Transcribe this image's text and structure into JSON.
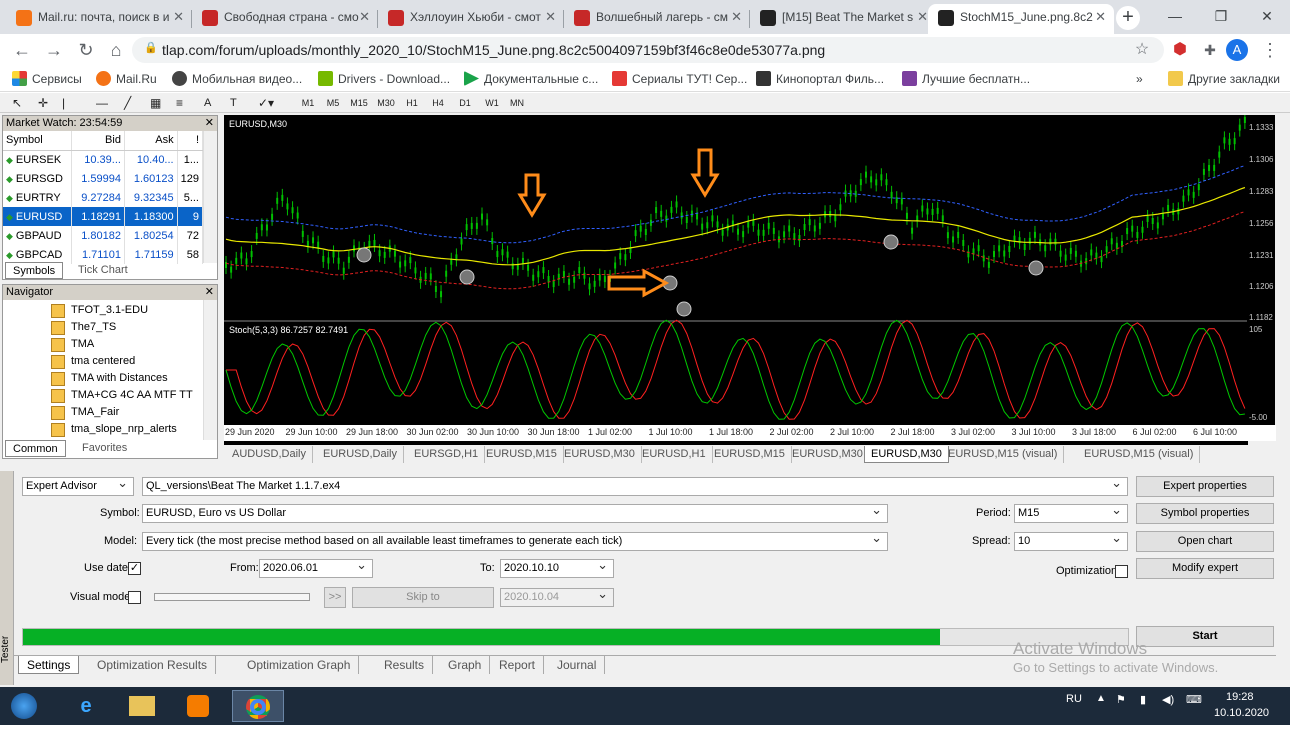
{
  "browser": {
    "tabs": [
      {
        "title": "Mail.ru: почта, поиск в и",
        "color": "#f47216"
      },
      {
        "title": "Свободная страна - смо",
        "color": "#c62828"
      },
      {
        "title": "Хэллоуин Хьюби - смот",
        "color": "#c62828"
      },
      {
        "title": "Волшебный лагерь - см",
        "color": "#c62828"
      },
      {
        "title": "[M15] Beat The Market s",
        "color": "#222222"
      },
      {
        "title": "StochM15_June.png.8c2",
        "color": "#222222"
      }
    ],
    "url": "tlap.com/forum/uploads/monthly_2020_10/StochM15_June.png.8c2c5004097159bf3f46c8e0de53077a.png",
    "avatar": "A",
    "bookmarks": [
      "Сервисы",
      "Mail.Ru",
      "Мобильная видео...",
      "Drivers - Download...",
      "Документальные с...",
      "Сериалы ТУТ! Сер...",
      "Кинопортал Филь...",
      "Лучшие бесплатн..."
    ],
    "other_bookmarks": "Другие закладки"
  },
  "mt4": {
    "timeframes": [
      "M1",
      "M5",
      "M15",
      "M30",
      "H1",
      "H4",
      "D1",
      "W1",
      "MN"
    ],
    "market_watch": {
      "title": "Market Watch: 23:54:59",
      "columns": [
        "Symbol",
        "Bid",
        "Ask",
        "!"
      ],
      "rows": [
        {
          "symbol": "EURSEK",
          "bid": "10.39...",
          "ask": "10.40...",
          "spread": "1..."
        },
        {
          "symbol": "EURSGD",
          "bid": "1.59994",
          "ask": "1.60123",
          "spread": "129"
        },
        {
          "symbol": "EURTRY",
          "bid": "9.27284",
          "ask": "9.32345",
          "spread": "5..."
        },
        {
          "symbol": "EURUSD",
          "bid": "1.18291",
          "ask": "1.18300",
          "spread": "9"
        },
        {
          "symbol": "GBPAUD",
          "bid": "1.80182",
          "ask": "1.80254",
          "spread": "72"
        },
        {
          "symbol": "GBPCAD",
          "bid": "1.71101",
          "ask": "1.71159",
          "spread": "58"
        }
      ],
      "tabs": [
        "Symbols",
        "Tick Chart"
      ]
    },
    "navigator": {
      "title": "Navigator",
      "items": [
        "TFOT_3.1-EDU",
        "The7_TS",
        "TMA",
        "tma centered",
        "TMA with Distances",
        "TMA+CG 4C AA MTF TT",
        "TMA_Fair",
        "tma_slope_nrp_alerts"
      ],
      "tabs": [
        "Common",
        "Favorites"
      ]
    },
    "chart": {
      "title": "EURUSD,M30",
      "stoch_label": "Stoch(5,3,3) 86.7257 82.7491",
      "price_labels": [
        "1.1333",
        "1.1306",
        "1.1283",
        "1.1256",
        "1.1231",
        "1.1206",
        "1.1182"
      ],
      "stoch_levels": [
        "105",
        "-5.00"
      ],
      "time_labels": [
        "29 Jun 2020",
        "29 Jun 10:00",
        "29 Jun 18:00",
        "30 Jun 02:00",
        "30 Jun 10:00",
        "30 Jun 18:00",
        "1 Jul 02:00",
        "1 Jul 10:00",
        "1 Jul 18:00",
        "2 Jul 02:00",
        "2 Jul 10:00",
        "2 Jul 18:00",
        "3 Jul 02:00",
        "3 Jul 10:00",
        "3 Jul 18:00",
        "6 Jul 02:00",
        "6 Jul 10:00"
      ],
      "tabs": [
        "AUDUSD,Daily",
        "EURUSD,Daily",
        "EURSGD,H1",
        "EURUSD,M15",
        "EURUSD,M30",
        "EURUSD,H1",
        "EURUSD,M15",
        "EURUSD,M30",
        "EURUSD,M30",
        "EURUSD,M15 (visual)",
        "EURUSD,M15 (visual)"
      ],
      "active_tab": 8,
      "colors": {
        "bull": "#00c000",
        "ma": "#e8e800",
        "upper": "#3060ff",
        "lower": "#e02020",
        "stoch_main": "#00c800",
        "stoch_signal": "#ff2020",
        "arrow": "#ff8c1a"
      }
    },
    "tester": {
      "mode": "Expert Advisor",
      "expert": "QL_versions\\Beat The Market 1.1.7.ex4",
      "symbol_label": "Symbol:",
      "symbol": "EURUSD, Euro vs US Dollar",
      "model_label": "Model:",
      "model": "Every tick (the most precise method based on all available least timeframes to generate each tick)",
      "use_date_label": "Use date",
      "use_date_checked": "✓",
      "from_label": "From:",
      "from": "2020.06.01",
      "to_label": "To:",
      "to": "2020.10.10",
      "visual_label": "Visual mode",
      "skip_btn": ">>",
      "skip_to": "Skip to",
      "skip_date": "2020.10.04",
      "period_label": "Period:",
      "period": "M15",
      "spread_label": "Spread:",
      "spread": "10",
      "optimization_label": "Optimization",
      "buttons": [
        "Expert properties",
        "Symbol properties",
        "Open chart",
        "Modify expert"
      ],
      "start": "Start",
      "progress": 0.83,
      "tabs": [
        "Settings",
        "Optimization Results",
        "Optimization Graph",
        "Results",
        "Graph",
        "Report",
        "Journal"
      ],
      "side_label": "Tester"
    },
    "watermark": {
      "line1": "Activate Windows",
      "line2": "Go to Settings to activate Windows."
    }
  },
  "taskbar": {
    "lang": "RU",
    "time": "19:28",
    "date": "10.10.2020"
  }
}
